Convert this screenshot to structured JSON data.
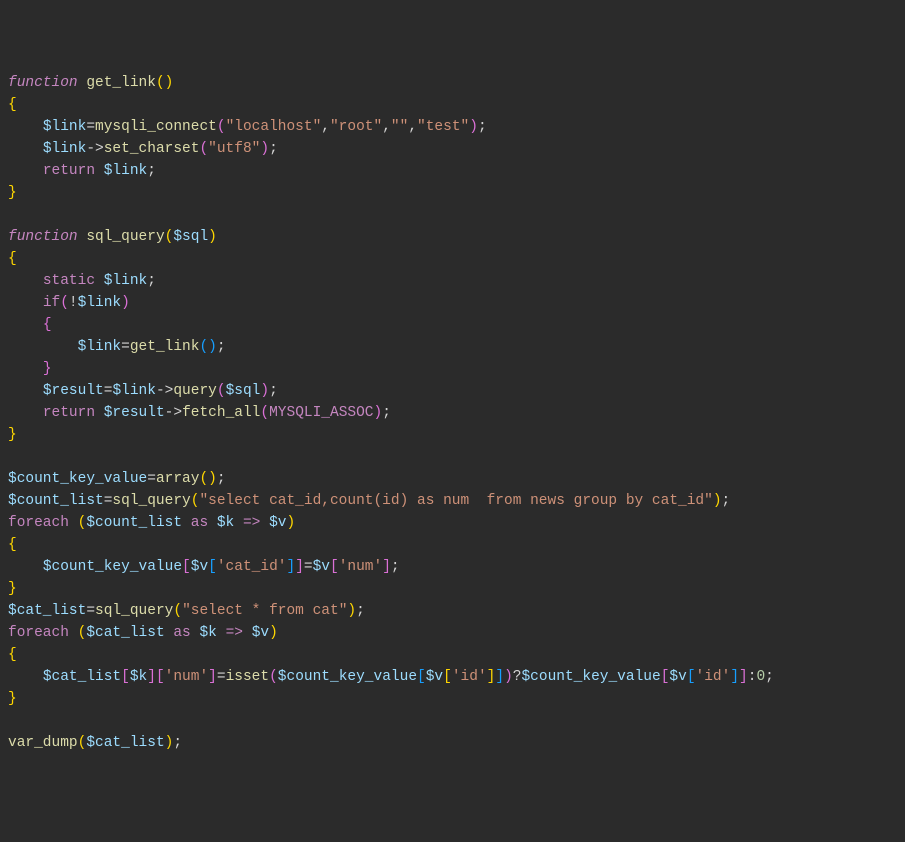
{
  "tokens": [
    [
      [
        "kw-ctrl",
        "function"
      ],
      [
        "punct",
        " "
      ],
      [
        "fn-name",
        "get_link"
      ],
      [
        "paren",
        "()"
      ]
    ],
    [
      [
        "brace",
        "{"
      ]
    ],
    [
      [
        "punct",
        "    "
      ],
      [
        "var",
        "$link"
      ],
      [
        "op",
        "="
      ],
      [
        "fn-call",
        "mysqli_connect"
      ],
      [
        "paren2",
        "("
      ],
      [
        "str",
        "\"localhost\""
      ],
      [
        "punct",
        ","
      ],
      [
        "str",
        "\"root\""
      ],
      [
        "punct",
        ","
      ],
      [
        "str",
        "\"\""
      ],
      [
        "punct",
        ","
      ],
      [
        "str",
        "\"test\""
      ],
      [
        "paren2",
        ")"
      ],
      [
        "punct",
        ";"
      ]
    ],
    [
      [
        "punct",
        "    "
      ],
      [
        "var",
        "$link"
      ],
      [
        "punct",
        "->"
      ],
      [
        "fn-call",
        "set_charset"
      ],
      [
        "paren2",
        "("
      ],
      [
        "str",
        "\"utf8\""
      ],
      [
        "paren2",
        ")"
      ],
      [
        "punct",
        ";"
      ]
    ],
    [
      [
        "punct",
        "    "
      ],
      [
        "kw",
        "return"
      ],
      [
        "punct",
        " "
      ],
      [
        "var",
        "$link"
      ],
      [
        "punct",
        ";"
      ]
    ],
    [
      [
        "brace",
        "}"
      ]
    ],
    [
      [
        "punct",
        ""
      ]
    ],
    [
      [
        "kw-ctrl",
        "function"
      ],
      [
        "punct",
        " "
      ],
      [
        "fn-name",
        "sql_query"
      ],
      [
        "paren",
        "("
      ],
      [
        "var",
        "$sql"
      ],
      [
        "paren",
        ")"
      ]
    ],
    [
      [
        "brace",
        "{"
      ]
    ],
    [
      [
        "punct",
        "    "
      ],
      [
        "kw",
        "static"
      ],
      [
        "punct",
        " "
      ],
      [
        "var",
        "$link"
      ],
      [
        "punct",
        ";"
      ]
    ],
    [
      [
        "punct",
        "    "
      ],
      [
        "kw",
        "if"
      ],
      [
        "paren2",
        "("
      ],
      [
        "punct",
        "!"
      ],
      [
        "var",
        "$link"
      ],
      [
        "paren2",
        ")"
      ]
    ],
    [
      [
        "punct",
        "    "
      ],
      [
        "brace2",
        "{"
      ]
    ],
    [
      [
        "punct",
        "        "
      ],
      [
        "var",
        "$link"
      ],
      [
        "op",
        "="
      ],
      [
        "fn-call",
        "get_link"
      ],
      [
        "paren3",
        "()"
      ],
      [
        "punct",
        ";"
      ]
    ],
    [
      [
        "punct",
        "    "
      ],
      [
        "brace2",
        "}"
      ]
    ],
    [
      [
        "punct",
        "    "
      ],
      [
        "var",
        "$result"
      ],
      [
        "op",
        "="
      ],
      [
        "var",
        "$link"
      ],
      [
        "punct",
        "->"
      ],
      [
        "fn-call",
        "query"
      ],
      [
        "paren2",
        "("
      ],
      [
        "var",
        "$sql"
      ],
      [
        "paren2",
        ")"
      ],
      [
        "punct",
        ";"
      ]
    ],
    [
      [
        "punct",
        "    "
      ],
      [
        "kw",
        "return"
      ],
      [
        "punct",
        " "
      ],
      [
        "var",
        "$result"
      ],
      [
        "punct",
        "->"
      ],
      [
        "fn-call",
        "fetch_all"
      ],
      [
        "paren2",
        "("
      ],
      [
        "const",
        "MYSQLI_ASSOC"
      ],
      [
        "paren2",
        ")"
      ],
      [
        "punct",
        ";"
      ]
    ],
    [
      [
        "brace",
        "}"
      ]
    ],
    [
      [
        "punct",
        ""
      ]
    ],
    [
      [
        "var",
        "$count_key_value"
      ],
      [
        "op",
        "="
      ],
      [
        "fn-call",
        "array"
      ],
      [
        "paren",
        "()"
      ],
      [
        "punct",
        ";"
      ]
    ],
    [
      [
        "var",
        "$count_list"
      ],
      [
        "op",
        "="
      ],
      [
        "fn-call",
        "sql_query"
      ],
      [
        "paren",
        "("
      ],
      [
        "str",
        "\"select cat_id,count(id) as num  from news group by cat_id\""
      ],
      [
        "paren",
        ")"
      ],
      [
        "punct",
        ";"
      ]
    ],
    [
      [
        "kw",
        "foreach"
      ],
      [
        "punct",
        " "
      ],
      [
        "paren",
        "("
      ],
      [
        "var",
        "$count_list"
      ],
      [
        "punct",
        " "
      ],
      [
        "kw",
        "as"
      ],
      [
        "punct",
        " "
      ],
      [
        "var",
        "$k"
      ],
      [
        "punct",
        " "
      ],
      [
        "kw",
        "=>"
      ],
      [
        "punct",
        " "
      ],
      [
        "var",
        "$v"
      ],
      [
        "paren",
        ")"
      ]
    ],
    [
      [
        "brace",
        "{"
      ]
    ],
    [
      [
        "punct",
        "    "
      ],
      [
        "var",
        "$count_key_value"
      ],
      [
        "paren2",
        "["
      ],
      [
        "var",
        "$v"
      ],
      [
        "paren3",
        "["
      ],
      [
        "str",
        "'cat_id'"
      ],
      [
        "paren3",
        "]"
      ],
      [
        "paren2",
        "]"
      ],
      [
        "op",
        "="
      ],
      [
        "var",
        "$v"
      ],
      [
        "paren2",
        "["
      ],
      [
        "str",
        "'num'"
      ],
      [
        "paren2",
        "]"
      ],
      [
        "punct",
        ";"
      ]
    ],
    [
      [
        "brace",
        "}"
      ]
    ],
    [
      [
        "var",
        "$cat_list"
      ],
      [
        "op",
        "="
      ],
      [
        "fn-call",
        "sql_query"
      ],
      [
        "paren",
        "("
      ],
      [
        "str",
        "\"select * from cat\""
      ],
      [
        "paren",
        ")"
      ],
      [
        "punct",
        ";"
      ]
    ],
    [
      [
        "kw",
        "foreach"
      ],
      [
        "punct",
        " "
      ],
      [
        "paren",
        "("
      ],
      [
        "var",
        "$cat_list"
      ],
      [
        "punct",
        " "
      ],
      [
        "kw",
        "as"
      ],
      [
        "punct",
        " "
      ],
      [
        "var",
        "$k"
      ],
      [
        "punct",
        " "
      ],
      [
        "kw",
        "=>"
      ],
      [
        "punct",
        " "
      ],
      [
        "var",
        "$v"
      ],
      [
        "paren",
        ")"
      ]
    ],
    [
      [
        "brace",
        "{"
      ]
    ],
    [
      [
        "punct",
        "    "
      ],
      [
        "var",
        "$cat_list"
      ],
      [
        "paren2",
        "["
      ],
      [
        "var",
        "$k"
      ],
      [
        "paren2",
        "]"
      ],
      [
        "paren2",
        "["
      ],
      [
        "str",
        "'num'"
      ],
      [
        "paren2",
        "]"
      ],
      [
        "op",
        "="
      ],
      [
        "fn-call",
        "isset"
      ],
      [
        "paren2",
        "("
      ],
      [
        "var",
        "$count_key_value"
      ],
      [
        "paren3",
        "["
      ],
      [
        "var",
        "$v"
      ],
      [
        "paren",
        "["
      ],
      [
        "str",
        "'id'"
      ],
      [
        "paren",
        "]"
      ],
      [
        "paren3",
        "]"
      ],
      [
        "paren2",
        ")"
      ],
      [
        "punct",
        "?"
      ],
      [
        "var",
        "$count_key_value"
      ],
      [
        "paren2",
        "["
      ],
      [
        "var",
        "$v"
      ],
      [
        "paren3",
        "["
      ],
      [
        "str",
        "'id'"
      ],
      [
        "paren3",
        "]"
      ],
      [
        "paren2",
        "]"
      ],
      [
        "punct",
        ":"
      ],
      [
        "num",
        "0"
      ],
      [
        "punct",
        ";"
      ]
    ],
    [
      [
        "brace",
        "}"
      ]
    ],
    [
      [
        "punct",
        ""
      ]
    ],
    [
      [
        "fn-call",
        "var_dump"
      ],
      [
        "paren",
        "("
      ],
      [
        "var",
        "$cat_list"
      ],
      [
        "paren",
        ")"
      ],
      [
        "punct",
        ";"
      ]
    ]
  ]
}
